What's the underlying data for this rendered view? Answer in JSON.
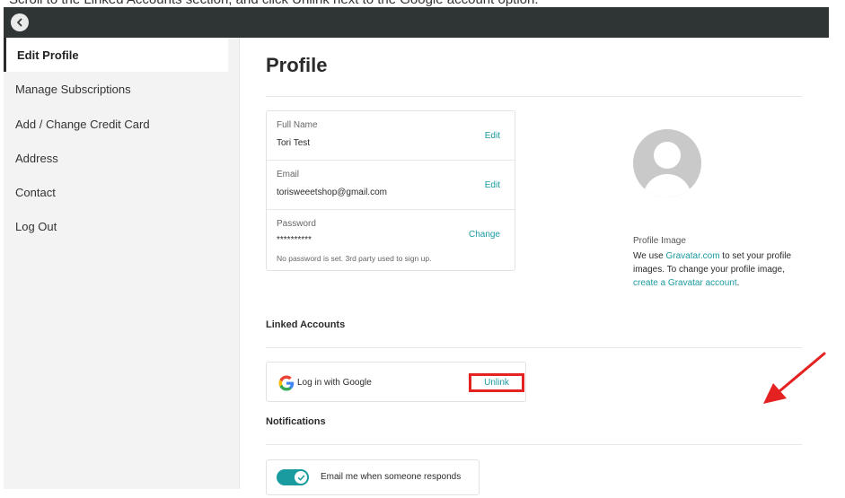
{
  "caption": "Scroll to the Linked Accounts section, and click Unlink next to the Google account option.",
  "sidebar": {
    "items": [
      {
        "label": "Edit Profile",
        "active": true
      },
      {
        "label": "Manage Subscriptions"
      },
      {
        "label": "Add / Change Credit Card"
      },
      {
        "label": "Address"
      },
      {
        "label": "Contact"
      },
      {
        "label": "Log Out"
      }
    ]
  },
  "main": {
    "title": "Profile",
    "full_name": {
      "label": "Full Name",
      "value": "Tori Test",
      "action": "Edit"
    },
    "email": {
      "label": "Email",
      "value": "torisweeetshop@gmail.com",
      "action": "Edit"
    },
    "password": {
      "label": "Password",
      "value": "**********",
      "action": "Change",
      "note": "No password is set. 3rd party used to sign up."
    },
    "profile_image": {
      "label": "Profile Image",
      "text_before": "We use ",
      "gravatar_link": "Gravatar.com",
      "text_middle": " to set your profile images. To change your profile image, ",
      "create_link": "create a Gravatar account",
      "text_after": "."
    },
    "linked_accounts": {
      "title": "Linked Accounts",
      "google_label": "Log in with Google",
      "unlink": "Unlink"
    },
    "notifications": {
      "title": "Notifications",
      "email_toggle_label": "Email me when someone responds",
      "email_toggle_on": true
    }
  },
  "colors": {
    "accent": "#1a9ba0",
    "highlight": "#e52222",
    "topbar": "#2f3435",
    "sidebar_bg": "#f3f3f3"
  },
  "icons": [
    "back-arrow-icon",
    "avatar-placeholder-icon",
    "google-icon",
    "check-icon"
  ]
}
